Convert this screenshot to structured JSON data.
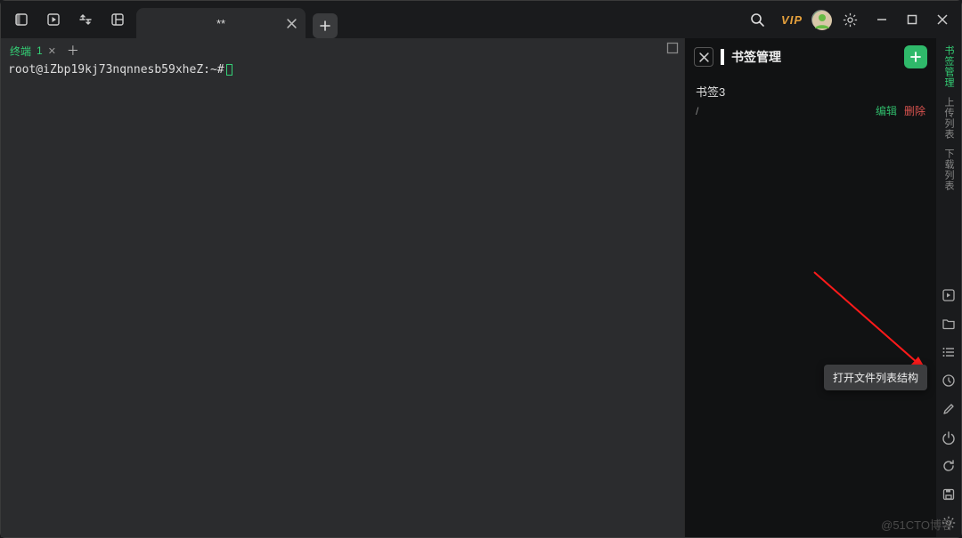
{
  "titlebar": {
    "tab_label": "**",
    "search_icon": "search-icon",
    "vip_label": "VIP"
  },
  "terminal": {
    "tab_label": "终端",
    "tab_number": "1",
    "prompt": "root@iZbp19kj73nqnnesb59xheZ:~#"
  },
  "bookmark_panel": {
    "title": "书签管理",
    "items": [
      {
        "name": "书签3",
        "path": "/",
        "edit_label": "编辑",
        "delete_label": "删除"
      }
    ]
  },
  "right_sidebar": {
    "tabs": [
      {
        "label": "书签管理",
        "active": true
      },
      {
        "label": "上传列表",
        "active": false
      },
      {
        "label": "下载列表",
        "active": false
      }
    ]
  },
  "tooltip": "打开文件列表结构",
  "watermark": "@51CTO博客"
}
